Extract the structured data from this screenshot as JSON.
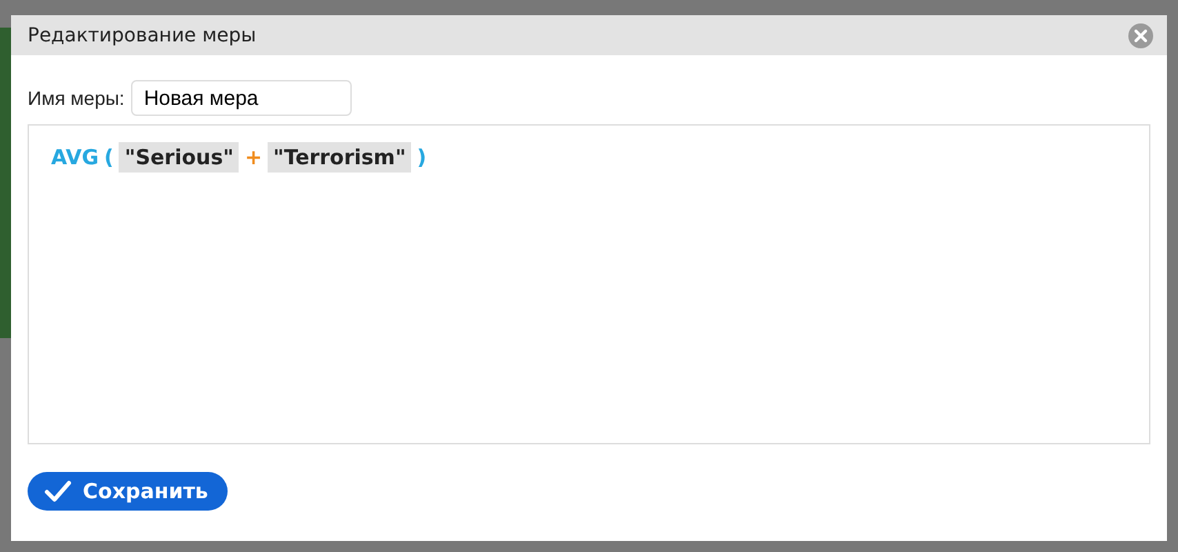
{
  "dialog": {
    "title": "Редактирование меры"
  },
  "name_field": {
    "label": "Имя меры:",
    "value": "Новая мера"
  },
  "formula": [
    {
      "kind": "function",
      "text": "AVG"
    },
    {
      "kind": "paren",
      "text": "("
    },
    {
      "kind": "field",
      "text": "\"Serious\""
    },
    {
      "kind": "operator",
      "text": "+"
    },
    {
      "kind": "field",
      "text": "\"Terrorism\""
    },
    {
      "kind": "paren",
      "text": ")"
    }
  ],
  "buttons": [
    {
      "label": "Сохранить"
    }
  ]
}
